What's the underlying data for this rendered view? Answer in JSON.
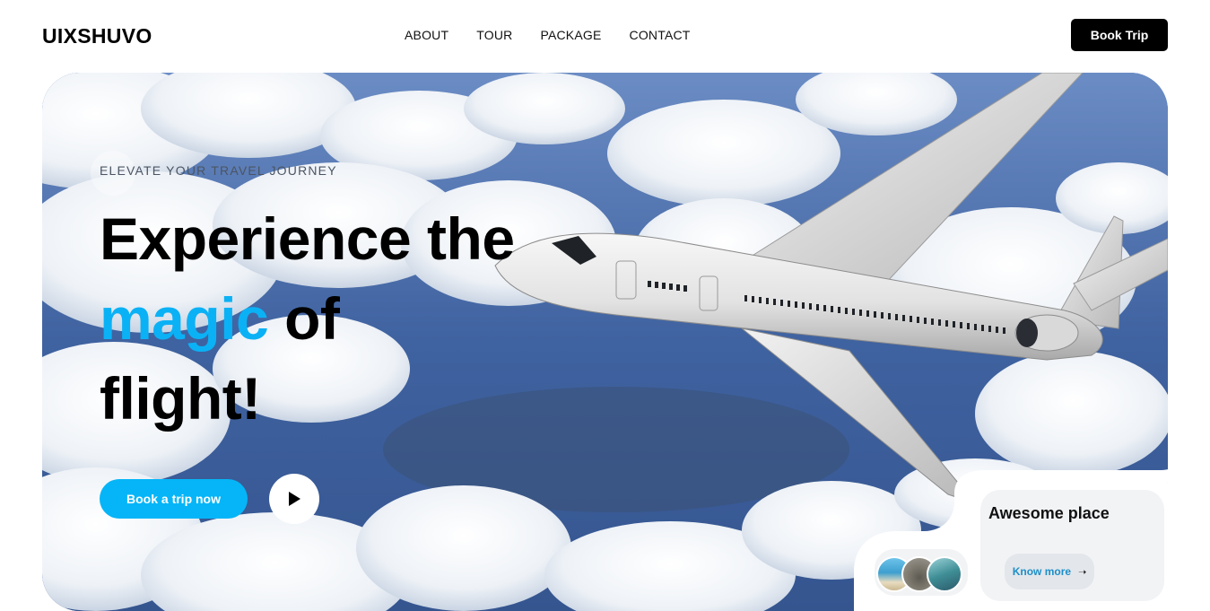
{
  "header": {
    "brand": "UIXSHUVO",
    "nav": [
      "ABOUT",
      "TOUR",
      "PACKAGE",
      "CONTACT"
    ],
    "book_button": "Book Trip"
  },
  "hero": {
    "eyebrow": "ELEVATE YOUR TRAVEL JOURNEY",
    "headline_line1": "Experience the",
    "headline_accent": "magic",
    "headline_line2_rest": " of",
    "headline_line3": "flight!",
    "cta_label": "Book a trip now",
    "accent_color": "#0bb1f5"
  },
  "card": {
    "title": "Awesome place",
    "know_more": "Know more",
    "arrow": "➝"
  },
  "icons": [
    "play-icon",
    "arrow-right-icon"
  ]
}
